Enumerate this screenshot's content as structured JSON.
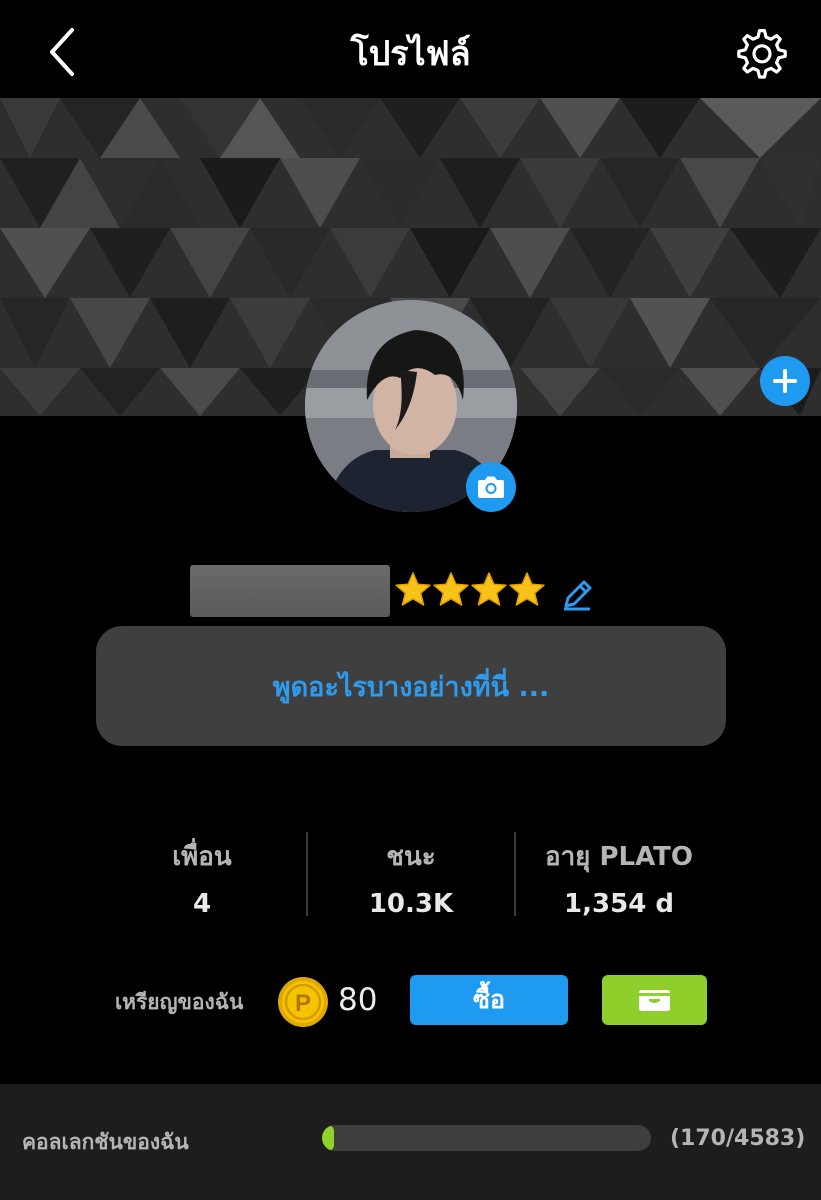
{
  "header": {
    "title": "โปรไฟล์",
    "back_icon": "chevron-left-icon",
    "settings_icon": "gear-icon"
  },
  "cover": {
    "add_icon": "plus-icon"
  },
  "profile": {
    "camera_icon": "camera-icon",
    "star_count": 4,
    "edit_icon": "pencil-icon",
    "status_placeholder": "พูดอะไรบางอย่างที่นี่ ..."
  },
  "stats": [
    {
      "label": "เพื่อน",
      "value": "4"
    },
    {
      "label": "ชนะ",
      "value": "10.3K"
    },
    {
      "label": "อายุ PLATO",
      "value": "1,354 d"
    }
  ],
  "coins": {
    "label": "เหรียญของฉัน",
    "icon": "coin-icon",
    "coin_symbol": "P",
    "count": "80",
    "buy_label": "ซื้อ",
    "wallet_icon": "wallet-icon"
  },
  "collection": {
    "label": "คอลเลกชันของฉัน",
    "count_text": "(170/4583)",
    "progress": 0.037
  },
  "colors": {
    "accent_blue": "#1e9af0",
    "accent_green": "#8fcf2c",
    "star_gold": "#f7c31a",
    "coin_gold": "#f5c400"
  }
}
